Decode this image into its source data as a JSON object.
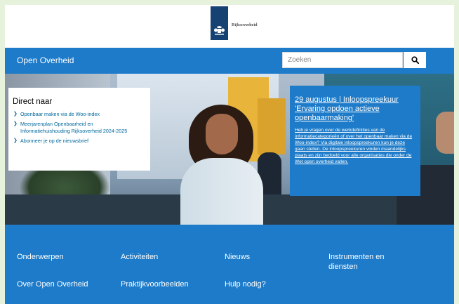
{
  "header": {
    "logo_text": "Rijksoverheid"
  },
  "nav": {
    "site_title": "Open Overheid",
    "search": {
      "placeholder": "Zoeken",
      "value": "",
      "button_icon": "search-icon"
    }
  },
  "direct_naar": {
    "title": "Direct naar",
    "items": [
      {
        "label": "Openbaar maken via de Woo-index"
      },
      {
        "label": "Meerjarenplan Openbaarheid en Informatiehuishouding Rijksoverheid 2024-2025"
      },
      {
        "label": "Abonneer je op de nieuwsbrief"
      }
    ]
  },
  "promo": {
    "title": "29 augustus | Inloopspreekuur 'Ervaring opdoen actieve openbaarmaking'",
    "body": "Heb je vragen over de werkdefinities van de informatiecategorieën of over het openbaar maken via de Woo-index? Via digitale inloopspreekuren kun je deze gaan stellen. De inloopspreekuren vinden maandelijks plaats en zijn bedoeld voor alle organisaties die onder de Wet open overheid vallen."
  },
  "footer": {
    "links": [
      {
        "label": "Onderwerpen"
      },
      {
        "label": "Activiteiten"
      },
      {
        "label": "Nieuws"
      },
      {
        "label": "Instrumenten en diensten"
      },
      {
        "label": "Over Open Overheid"
      },
      {
        "label": "Praktijkvoorbeelden"
      },
      {
        "label": "Hulp nodig?"
      }
    ]
  },
  "colors": {
    "brand_blue": "#1d7bc9",
    "logo_navy": "#154273",
    "link_blue": "#01689b"
  }
}
